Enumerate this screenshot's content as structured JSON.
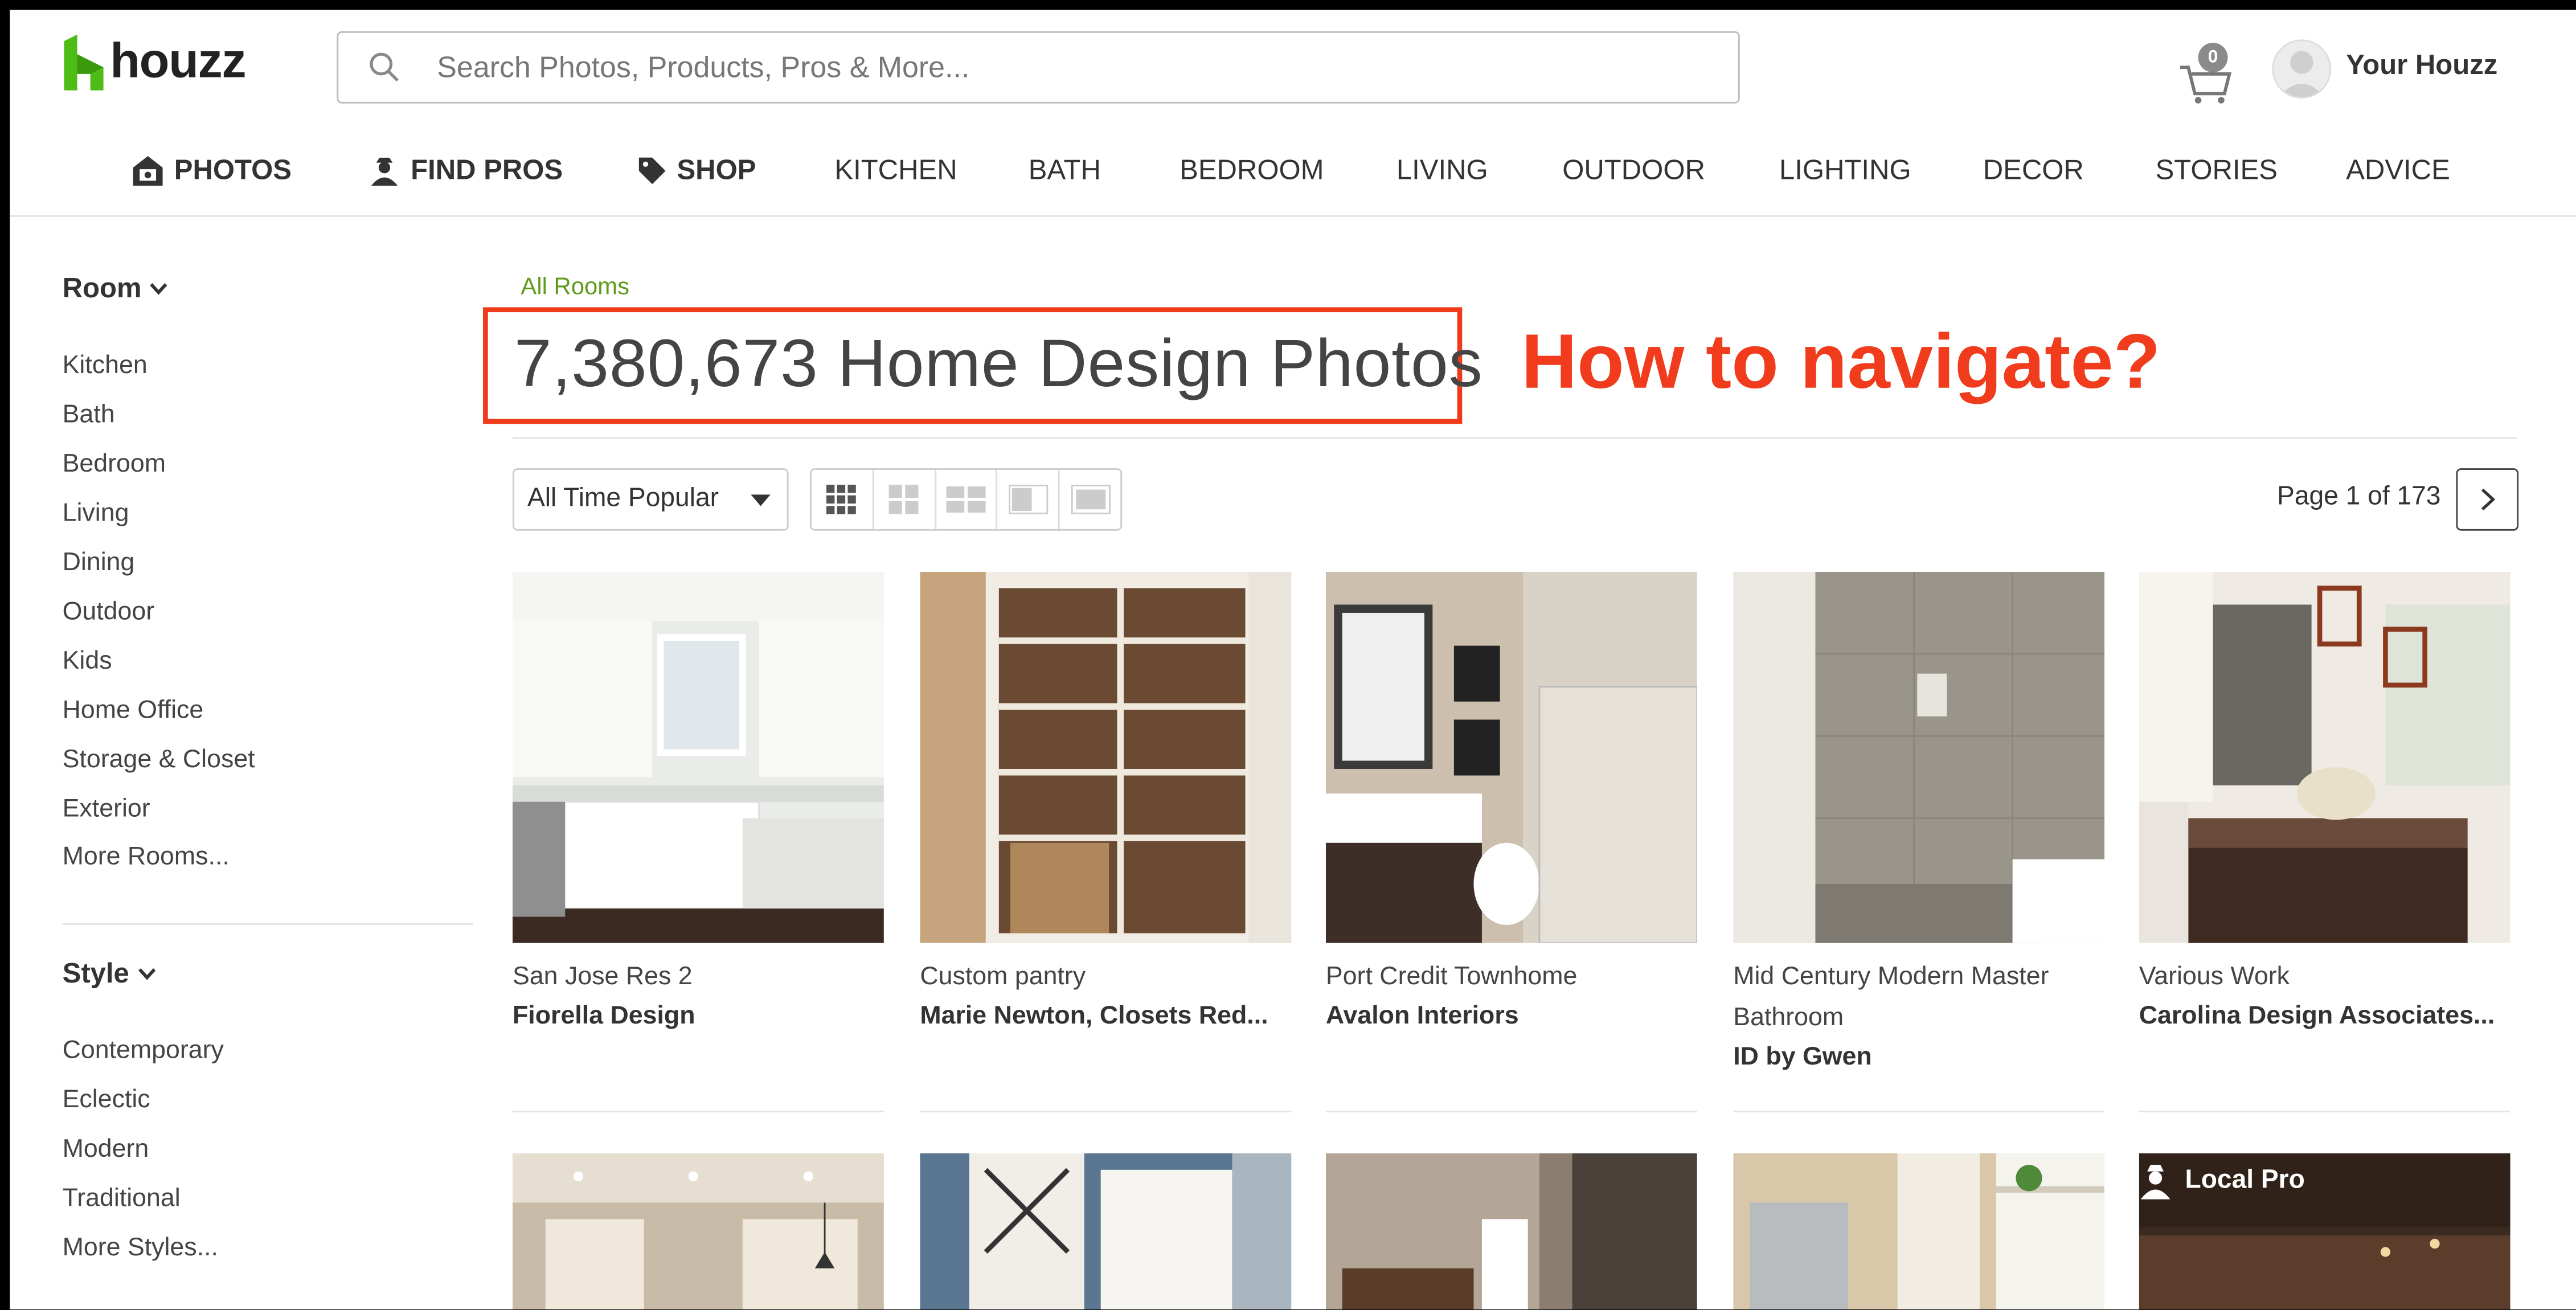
{
  "brand": {
    "name": "houzz",
    "accent": "#4dbc15"
  },
  "search": {
    "placeholder": "Search Photos, Products, Pros & More..."
  },
  "cart": {
    "count": "0"
  },
  "user": {
    "label": "Your Houzz"
  },
  "nav": [
    {
      "label": "PHOTOS",
      "icon": "house-photo-icon"
    },
    {
      "label": "FIND PROS",
      "icon": "pro-person-icon"
    },
    {
      "label": "SHOP",
      "icon": "tag-icon"
    },
    {
      "label": "KITCHEN"
    },
    {
      "label": "BATH"
    },
    {
      "label": "BEDROOM"
    },
    {
      "label": "LIVING"
    },
    {
      "label": "OUTDOOR"
    },
    {
      "label": "LIGHTING"
    },
    {
      "label": "DECOR"
    },
    {
      "label": "STORIES"
    },
    {
      "label": "ADVICE"
    }
  ],
  "sidebar": {
    "room": {
      "heading": "Room",
      "items": [
        "Kitchen",
        "Bath",
        "Bedroom",
        "Living",
        "Dining",
        "Outdoor",
        "Kids",
        "Home Office",
        "Storage & Closet",
        "Exterior",
        "More Rooms..."
      ]
    },
    "style": {
      "heading": "Style",
      "items": [
        "Contemporary",
        "Eclectic",
        "Modern",
        "Traditional",
        "More Styles..."
      ]
    }
  },
  "main": {
    "breadcrumb": "All Rooms",
    "title": "7,380,673 Home Design Photos",
    "annotation": "How to navigate?",
    "annotation_color": "#f03c1d",
    "sort": {
      "selected": "All Time Popular"
    },
    "pager": {
      "label": "Page 1 of 173"
    },
    "photos": [
      {
        "title": "San Jose Res 2",
        "pro": "Fiorella Design"
      },
      {
        "title": "Custom pantry",
        "pro": "Marie Newton, Closets Red..."
      },
      {
        "title": "Port Credit Townhome",
        "pro": "Avalon Interiors"
      },
      {
        "title": "Mid Century Modern Master Bathroom",
        "pro": "ID by Gwen"
      },
      {
        "title": "Various Work",
        "pro": "Carolina Design Associates..."
      }
    ],
    "local_pro": "Local Pro"
  }
}
